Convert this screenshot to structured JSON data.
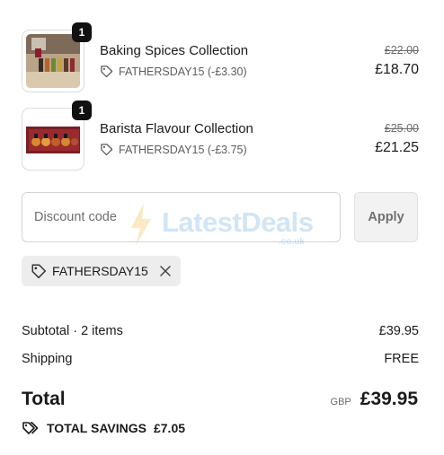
{
  "cart": {
    "items": [
      {
        "name": "Baking Spices Collection",
        "quantity": "1",
        "discount": "FATHERSDAY15 (-£3.30)",
        "original_price": "£22.00",
        "price": "£18.70",
        "image": "baking-spices-product-image"
      },
      {
        "name": "Barista Flavour Collection",
        "quantity": "1",
        "discount": "FATHERSDAY15 (-£3.75)",
        "original_price": "£25.00",
        "price": "£21.25",
        "image": "barista-flavour-product-image"
      }
    ]
  },
  "discount": {
    "placeholder": "Discount code",
    "value": "",
    "apply_label": "Apply",
    "applied_code": "FATHERSDAY15"
  },
  "summary": {
    "subtotal_label": "Subtotal · 2 items",
    "subtotal_value": "£39.95",
    "shipping_label": "Shipping",
    "shipping_value": "FREE",
    "total_label": "Total",
    "currency": "GBP",
    "total_value": "£39.95",
    "savings_label": "TOTAL SAVINGS",
    "savings_value": "£7.05"
  },
  "watermark": {
    "text": "LatestDeals",
    "subtext": ".co.uk"
  },
  "colors": {
    "badge": "#111111",
    "chip_bg": "#ededed",
    "apply_bg": "#f2f2f2",
    "watermark": "#5aa3e0"
  }
}
